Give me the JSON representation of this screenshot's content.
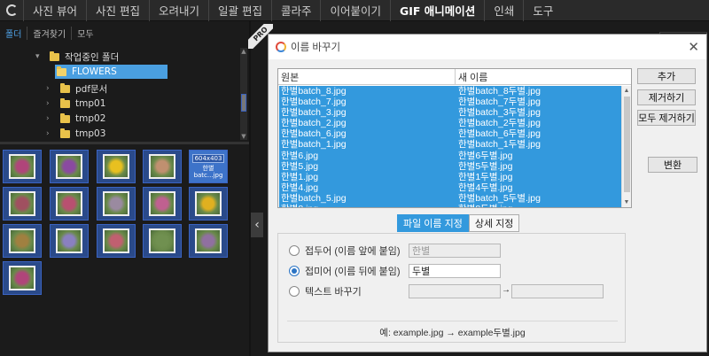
{
  "menu": {
    "items": [
      "사진 뷰어",
      "사진 편집",
      "오려내기",
      "일괄 편집",
      "콜라주",
      "이어붙이기",
      "GIF 애니메이션",
      "인쇄",
      "도구"
    ],
    "active_index": 6
  },
  "sidebar": {
    "tabs": [
      "폴더",
      "즐겨찾기",
      "모두"
    ],
    "tree": [
      {
        "label": "작업중인 폴더",
        "expanded": true
      },
      {
        "label": "FLOWERS",
        "selected": true
      },
      {
        "label": "pdf문서"
      },
      {
        "label": "tmp01"
      },
      {
        "label": "tmp02"
      },
      {
        "label": "tmp03"
      }
    ],
    "info_thumb": {
      "resolution": "604x403",
      "line1": "한별",
      "line2": "batc...jpg"
    },
    "photo_colors": [
      "#b0457a",
      "#8a4aa0",
      "#e8c020",
      "#c09070",
      "#a05060",
      "#b85070",
      "#9a8aa0",
      "#c06090",
      "#e0b020",
      "#a08040",
      "#8a80c0",
      "#c06070",
      "#709050",
      "#9070a0"
    ]
  },
  "pro_badge": "PRO",
  "dialog": {
    "title": "이름 바꾸기",
    "columns": {
      "original": "원본",
      "new_name": "새 이름"
    },
    "rows": [
      [
        "한별batch_8.jpg",
        "한별batch_8두별.jpg"
      ],
      [
        "한별batch_7.jpg",
        "한별batch_7두별.jpg"
      ],
      [
        "한별batch_3.jpg",
        "한별batch_3두별.jpg"
      ],
      [
        "한별batch_2.jpg",
        "한별batch_2두별.jpg"
      ],
      [
        "한별batch_6.jpg",
        "한별batch_6두별.jpg"
      ],
      [
        "한별batch_1.jpg",
        "한별batch_1두별.jpg"
      ],
      [
        "한별6.jpg",
        "한별6두별.jpg"
      ],
      [
        "한별5.jpg",
        "한별5두별.jpg"
      ],
      [
        "한별1.jpg",
        "한별1두별.jpg"
      ],
      [
        "한별4.jpg",
        "한별4두별.jpg"
      ],
      [
        "한별batch_5.jpg",
        "한별batch_5두별.jpg"
      ],
      [
        "한별8.jpg",
        "한별8두별.jpg"
      ]
    ],
    "buttons": {
      "add": "추가",
      "remove": "제거하기",
      "remove_all": "모두 제거하기",
      "convert": "변환"
    },
    "tabs": {
      "filename": "파일 이름 지정",
      "detail": "상세 지정"
    },
    "options": {
      "prefix": {
        "label": "접두어 (이름 앞에 붙임)",
        "value": "한별"
      },
      "suffix": {
        "label": "접미어 (이름 뒤에 붙임)",
        "value": "두별"
      },
      "replace": {
        "label": "텍스트 바꾸기",
        "arrow": "→"
      }
    },
    "example": "예: example.jpg → example두별.jpg"
  }
}
